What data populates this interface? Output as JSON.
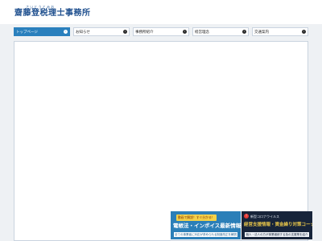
{
  "header": {
    "logo_ruby": "さいとうとみお",
    "logo_name": "齋藤登税理士事務所"
  },
  "nav": {
    "items": [
      {
        "label": "トップページ",
        "arrow": "›",
        "active": true
      },
      {
        "label": "お知らせ",
        "arrow": "›",
        "active": false
      },
      {
        "label": "事務所紹介",
        "arrow": "›",
        "active": false
      },
      {
        "label": "経営理念",
        "arrow": "›",
        "active": false
      },
      {
        "label": "交通案内",
        "arrow": "›",
        "active": false
      }
    ]
  },
  "banners": {
    "invoice": {
      "badge": "動画で解説！すぐ分かる！",
      "title": "電帳法・インボイス最新情報",
      "sub": "全ての事業者に対応が求められる制度改正を解説"
    },
    "corona": {
      "small": "新型コロナウイルス",
      "title": "経営支援情報・資金繰り対策コーナー",
      "sub": "個人・法人の方が事業継続する為の支援策を紹介"
    }
  },
  "colors": {
    "brand": "#1e4f8e",
    "nav_active": "#2a80bd",
    "banner_blue": "#2b7fb8",
    "banner_navy": "#17243a",
    "badge_yellow": "#f4d24a"
  }
}
